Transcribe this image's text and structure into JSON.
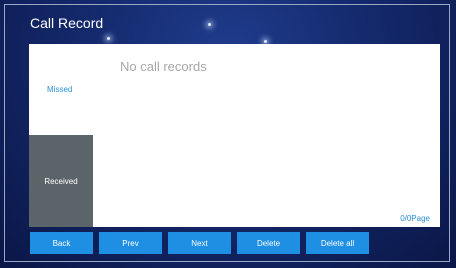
{
  "window": {
    "title": "Call Record"
  },
  "tabs": {
    "missed": "Missed",
    "received": "Received"
  },
  "list": {
    "empty_message": "No call records",
    "page_indicator": "0/0Page"
  },
  "buttons": {
    "back": "Back",
    "prev": "Prev",
    "next": "Next",
    "delete": "Delete",
    "delete_all": "Delete all"
  },
  "colors": {
    "background": "#14296c",
    "button": "#1f8fe4",
    "selected_tab": "#5b6569",
    "accent_text": "#2a8fd6"
  }
}
